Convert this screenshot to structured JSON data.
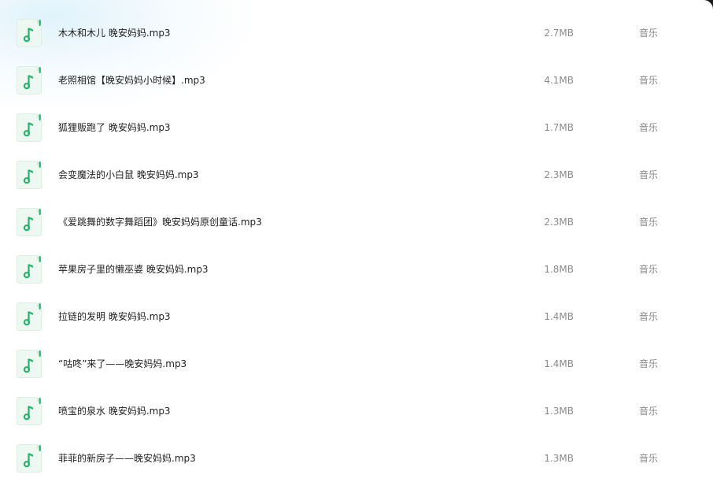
{
  "file_list": {
    "icon": "music-file-icon",
    "accent_color": "#25b36a",
    "rows": [
      {
        "name": "木木和木儿 晚安妈妈.mp3",
        "size": "2.7MB",
        "type": "音乐"
      },
      {
        "name": "老照相馆【晚安妈妈小时候】.mp3",
        "size": "4.1MB",
        "type": "音乐"
      },
      {
        "name": "狐狸贩跑了 晚安妈妈.mp3",
        "size": "1.7MB",
        "type": "音乐"
      },
      {
        "name": "会变魔法的小白鼠 晚安妈妈.mp3",
        "size": "2.3MB",
        "type": "音乐"
      },
      {
        "name": "《爱跳舞的数字舞蹈团》晚安妈妈原创童话.mp3",
        "size": "2.3MB",
        "type": "音乐"
      },
      {
        "name": "苹果房子里的懒巫婆 晚安妈妈.mp3",
        "size": "1.8MB",
        "type": "音乐"
      },
      {
        "name": "拉链的发明 晚安妈妈.mp3",
        "size": "1.4MB",
        "type": "音乐"
      },
      {
        "name": "“咕咚”来了——晚安妈妈.mp3",
        "size": "1.4MB",
        "type": "音乐"
      },
      {
        "name": "喷宝的泉水 晚安妈妈.mp3",
        "size": "1.3MB",
        "type": "音乐"
      },
      {
        "name": "菲菲的新房子——晚安妈妈.mp3",
        "size": "1.3MB",
        "type": "音乐"
      }
    ]
  }
}
